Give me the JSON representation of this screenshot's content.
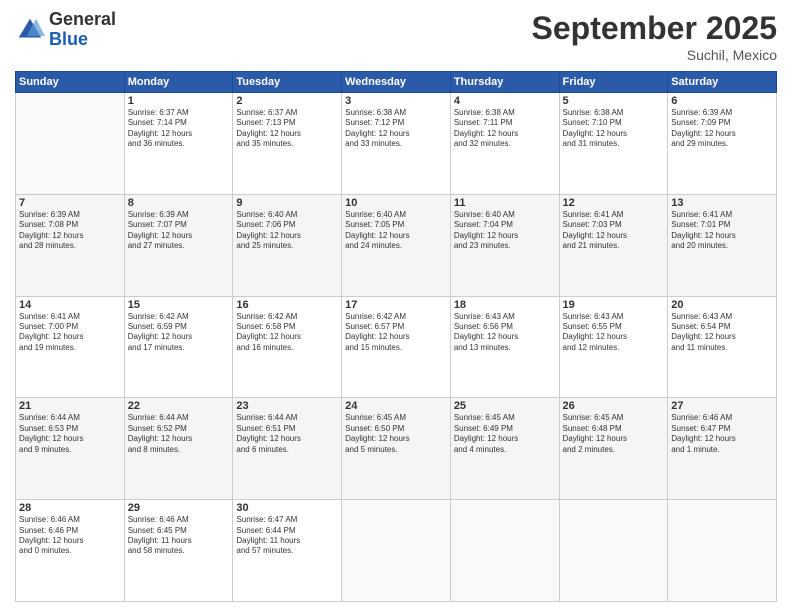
{
  "header": {
    "logo_line1": "General",
    "logo_line2": "Blue",
    "month": "September 2025",
    "location": "Suchil, Mexico"
  },
  "weekdays": [
    "Sunday",
    "Monday",
    "Tuesday",
    "Wednesday",
    "Thursday",
    "Friday",
    "Saturday"
  ],
  "weeks": [
    [
      {
        "date": "",
        "info": ""
      },
      {
        "date": "1",
        "info": "Sunrise: 6:37 AM\nSunset: 7:14 PM\nDaylight: 12 hours\nand 36 minutes."
      },
      {
        "date": "2",
        "info": "Sunrise: 6:37 AM\nSunset: 7:13 PM\nDaylight: 12 hours\nand 35 minutes."
      },
      {
        "date": "3",
        "info": "Sunrise: 6:38 AM\nSunset: 7:12 PM\nDaylight: 12 hours\nand 33 minutes."
      },
      {
        "date": "4",
        "info": "Sunrise: 6:38 AM\nSunset: 7:11 PM\nDaylight: 12 hours\nand 32 minutes."
      },
      {
        "date": "5",
        "info": "Sunrise: 6:38 AM\nSunset: 7:10 PM\nDaylight: 12 hours\nand 31 minutes."
      },
      {
        "date": "6",
        "info": "Sunrise: 6:39 AM\nSunset: 7:09 PM\nDaylight: 12 hours\nand 29 minutes."
      }
    ],
    [
      {
        "date": "7",
        "info": "Sunrise: 6:39 AM\nSunset: 7:08 PM\nDaylight: 12 hours\nand 28 minutes."
      },
      {
        "date": "8",
        "info": "Sunrise: 6:39 AM\nSunset: 7:07 PM\nDaylight: 12 hours\nand 27 minutes."
      },
      {
        "date": "9",
        "info": "Sunrise: 6:40 AM\nSunset: 7:06 PM\nDaylight: 12 hours\nand 25 minutes."
      },
      {
        "date": "10",
        "info": "Sunrise: 6:40 AM\nSunset: 7:05 PM\nDaylight: 12 hours\nand 24 minutes."
      },
      {
        "date": "11",
        "info": "Sunrise: 6:40 AM\nSunset: 7:04 PM\nDaylight: 12 hours\nand 23 minutes."
      },
      {
        "date": "12",
        "info": "Sunrise: 6:41 AM\nSunset: 7:03 PM\nDaylight: 12 hours\nand 21 minutes."
      },
      {
        "date": "13",
        "info": "Sunrise: 6:41 AM\nSunset: 7:01 PM\nDaylight: 12 hours\nand 20 minutes."
      }
    ],
    [
      {
        "date": "14",
        "info": "Sunrise: 6:41 AM\nSunset: 7:00 PM\nDaylight: 12 hours\nand 19 minutes."
      },
      {
        "date": "15",
        "info": "Sunrise: 6:42 AM\nSunset: 6:59 PM\nDaylight: 12 hours\nand 17 minutes."
      },
      {
        "date": "16",
        "info": "Sunrise: 6:42 AM\nSunset: 6:58 PM\nDaylight: 12 hours\nand 16 minutes."
      },
      {
        "date": "17",
        "info": "Sunrise: 6:42 AM\nSunset: 6:57 PM\nDaylight: 12 hours\nand 15 minutes."
      },
      {
        "date": "18",
        "info": "Sunrise: 6:43 AM\nSunset: 6:56 PM\nDaylight: 12 hours\nand 13 minutes."
      },
      {
        "date": "19",
        "info": "Sunrise: 6:43 AM\nSunset: 6:55 PM\nDaylight: 12 hours\nand 12 minutes."
      },
      {
        "date": "20",
        "info": "Sunrise: 6:43 AM\nSunset: 6:54 PM\nDaylight: 12 hours\nand 11 minutes."
      }
    ],
    [
      {
        "date": "21",
        "info": "Sunrise: 6:44 AM\nSunset: 6:53 PM\nDaylight: 12 hours\nand 9 minutes."
      },
      {
        "date": "22",
        "info": "Sunrise: 6:44 AM\nSunset: 6:52 PM\nDaylight: 12 hours\nand 8 minutes."
      },
      {
        "date": "23",
        "info": "Sunrise: 6:44 AM\nSunset: 6:51 PM\nDaylight: 12 hours\nand 6 minutes."
      },
      {
        "date": "24",
        "info": "Sunrise: 6:45 AM\nSunset: 6:50 PM\nDaylight: 12 hours\nand 5 minutes."
      },
      {
        "date": "25",
        "info": "Sunrise: 6:45 AM\nSunset: 6:49 PM\nDaylight: 12 hours\nand 4 minutes."
      },
      {
        "date": "26",
        "info": "Sunrise: 6:45 AM\nSunset: 6:48 PM\nDaylight: 12 hours\nand 2 minutes."
      },
      {
        "date": "27",
        "info": "Sunrise: 6:46 AM\nSunset: 6:47 PM\nDaylight: 12 hours\nand 1 minute."
      }
    ],
    [
      {
        "date": "28",
        "info": "Sunrise: 6:46 AM\nSunset: 6:46 PM\nDaylight: 12 hours\nand 0 minutes."
      },
      {
        "date": "29",
        "info": "Sunrise: 6:46 AM\nSunset: 6:45 PM\nDaylight: 11 hours\nand 58 minutes."
      },
      {
        "date": "30",
        "info": "Sunrise: 6:47 AM\nSunset: 6:44 PM\nDaylight: 11 hours\nand 57 minutes."
      },
      {
        "date": "",
        "info": ""
      },
      {
        "date": "",
        "info": ""
      },
      {
        "date": "",
        "info": ""
      },
      {
        "date": "",
        "info": ""
      }
    ]
  ]
}
